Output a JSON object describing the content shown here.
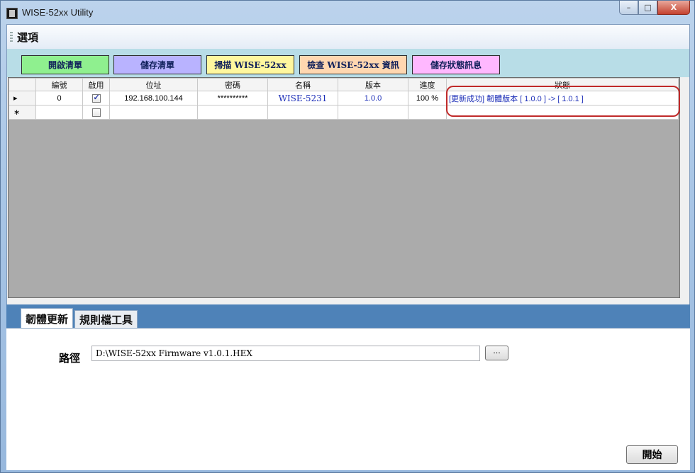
{
  "window": {
    "title": "WISE-52xx Utility",
    "controls": {
      "minimize": "–",
      "maximize": "□",
      "close": "X"
    }
  },
  "menu": {
    "items": [
      {
        "label": "選項"
      }
    ]
  },
  "toolbar": {
    "open_list": "開啟清單",
    "save_list": "儲存清單",
    "scan": "掃描 WISE-52xx",
    "check_info": "檢查 WISE-52xx 資訊",
    "save_status": "儲存狀態訊息",
    "colors": {
      "open_list": "#8ff08f",
      "save_list": "#b9b3ff",
      "scan": "#fff79e",
      "check_info": "#ffd7b0",
      "save_status": "#ffb8ff"
    }
  },
  "grid": {
    "columns": [
      "編號",
      "啟用",
      "位址",
      "密碼",
      "名稱",
      "版本",
      "進度",
      "狀態"
    ],
    "rows": [
      {
        "row_marker": "▸",
        "id": "0",
        "enabled": true,
        "address": "192.168.100.144",
        "password": "**********",
        "name": "WISE-5231",
        "version": "1.0.0",
        "progress": "100 %",
        "status": "[更新成功] 韌體版本 [ 1.0.0 ] -> [ 1.0.1 ]"
      }
    ],
    "new_row": {
      "row_marker": "∗",
      "enabled": false
    }
  },
  "tabs": [
    {
      "label": "韌體更新",
      "active": true
    },
    {
      "label": "規則檔工具",
      "active": false
    }
  ],
  "firmware": {
    "path_label": "路徑",
    "path_value": "D:\\WISE-52xx Firmware v1.0.1.HEX",
    "browse_label": "...",
    "start_label": "開始"
  }
}
